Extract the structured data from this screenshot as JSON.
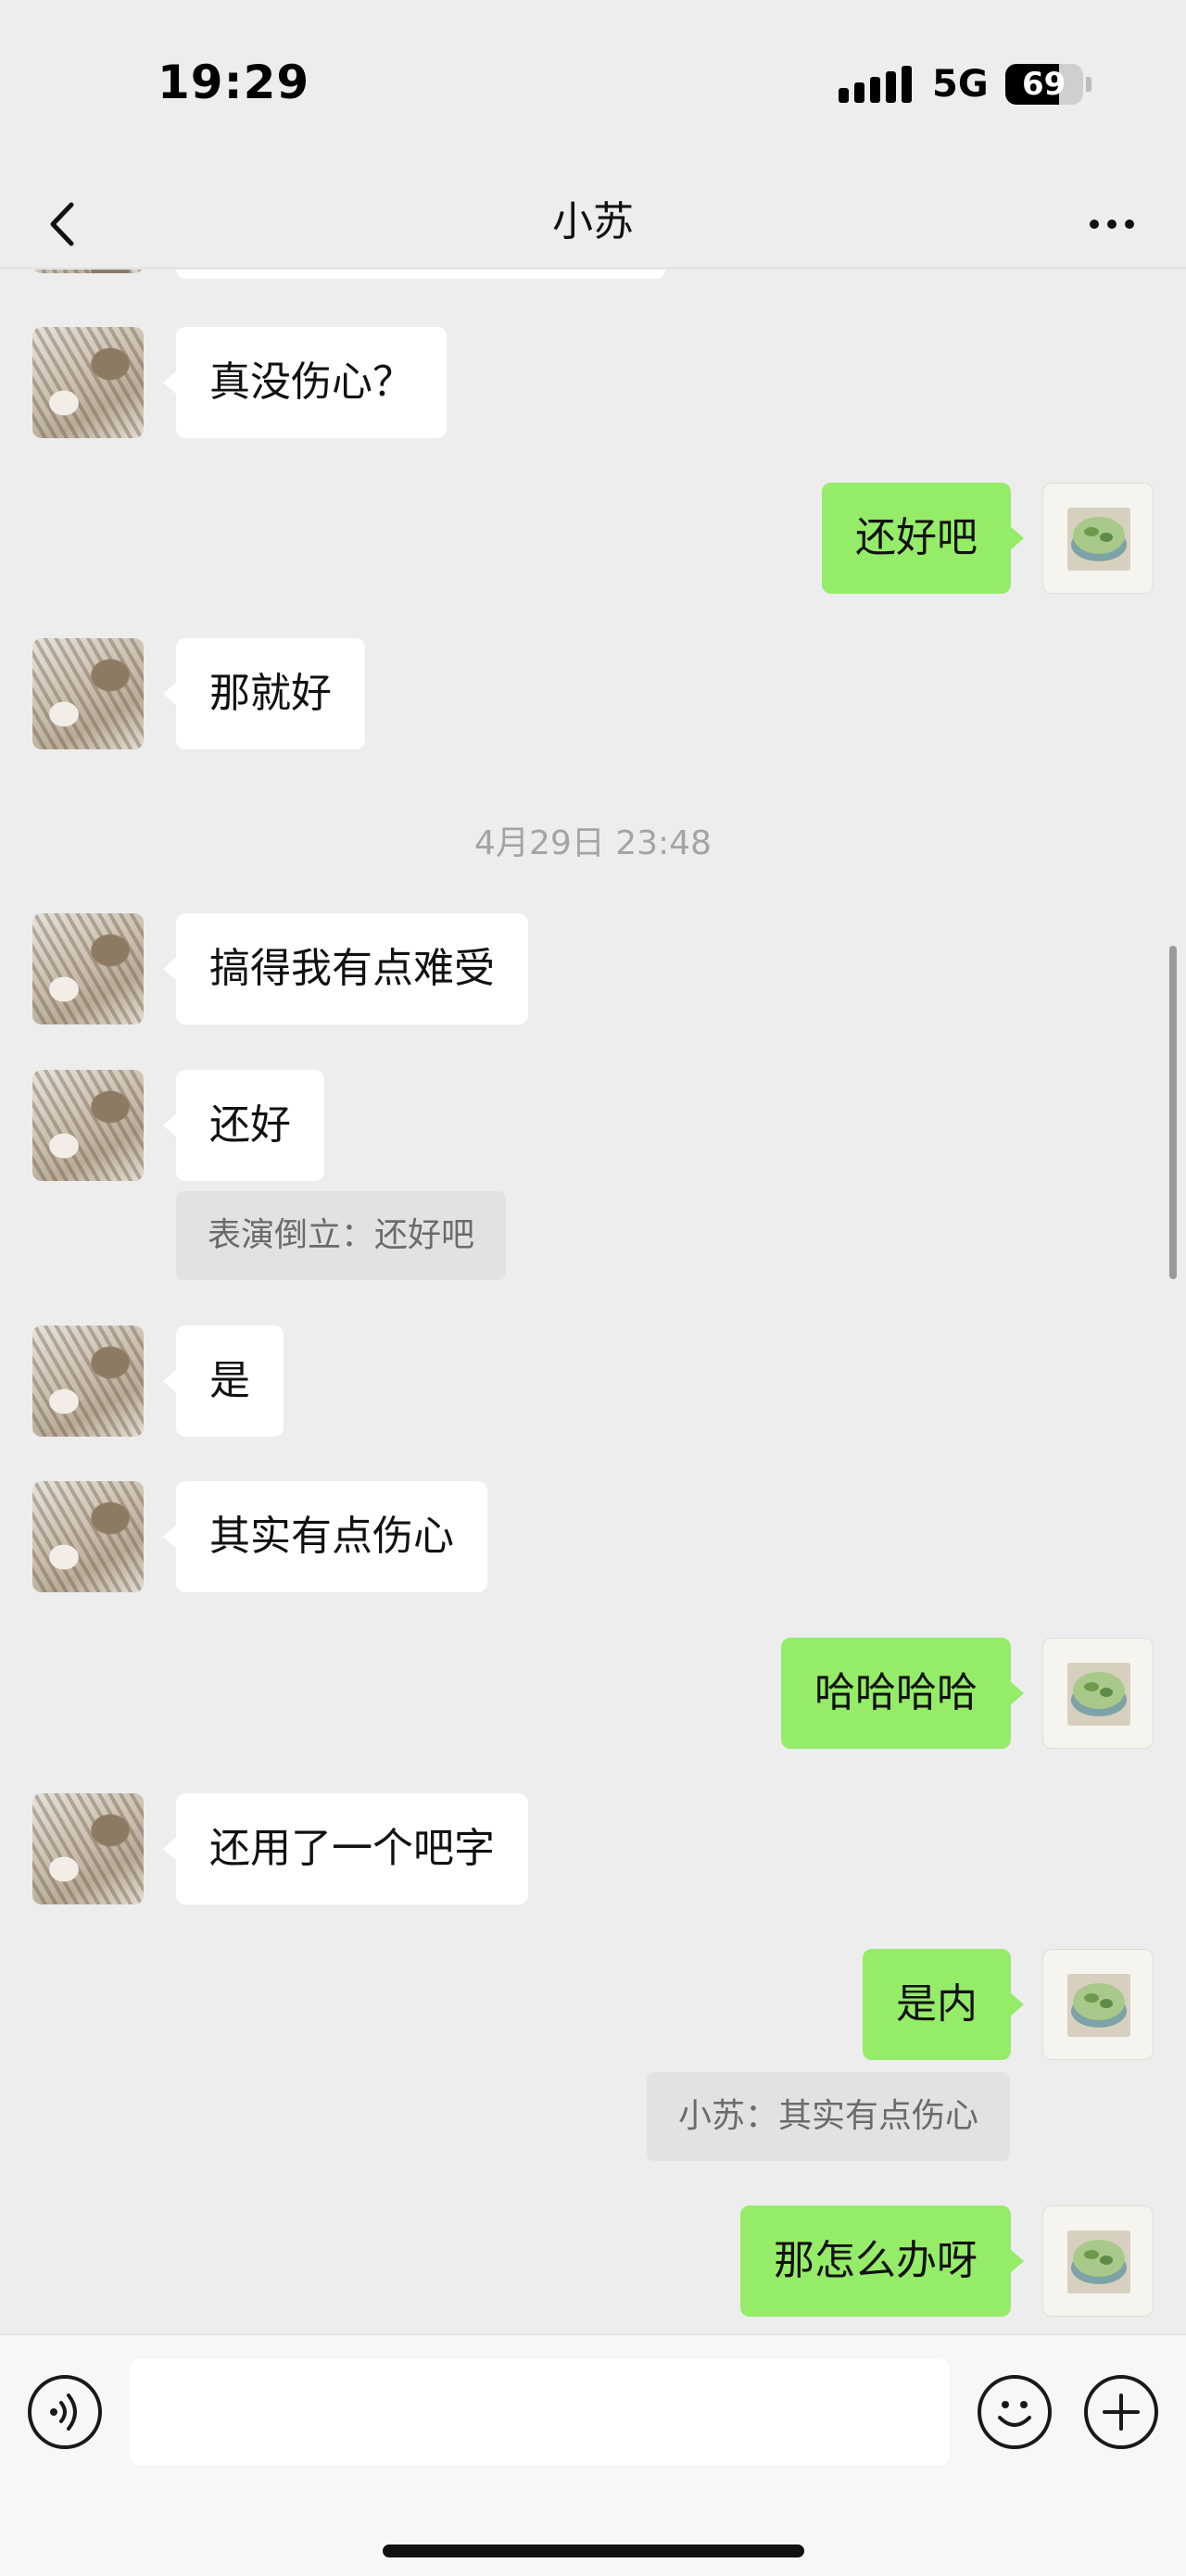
{
  "status_bar": {
    "time": "19:29",
    "network": "5G",
    "battery": "69",
    "battery_level": 0.69
  },
  "header": {
    "title": "小苏",
    "back_icon": "chevron-left-icon",
    "more_icon": "ellipsis-icon"
  },
  "messages": [
    {
      "side": "in",
      "text": "真没伤心？"
    },
    {
      "side": "out",
      "text": "还好吧"
    },
    {
      "side": "in",
      "text": "那就好"
    },
    {
      "side": "in",
      "text": "搞得我有点难受"
    },
    {
      "side": "in",
      "text": "还好",
      "quote": "表演倒立：还好吧"
    },
    {
      "side": "in",
      "text": "是"
    },
    {
      "side": "in",
      "text": "其实有点伤心"
    },
    {
      "side": "out",
      "text": "哈哈哈哈"
    },
    {
      "side": "in",
      "text": "还用了一个吧字"
    },
    {
      "side": "out",
      "text": "是内",
      "quote": "小苏：其实有点伤心"
    },
    {
      "side": "out",
      "text": "那怎么办呀"
    }
  ],
  "timestamp": "4月29日 23:48",
  "input_bar": {
    "voice_icon": "voice-icon",
    "emoji_icon": "emoji-icon",
    "plus_icon": "plus-icon",
    "value": ""
  },
  "colors": {
    "background": "#ededed",
    "incoming_bubble": "#ffffff",
    "outgoing_bubble": "#95ec69"
  }
}
